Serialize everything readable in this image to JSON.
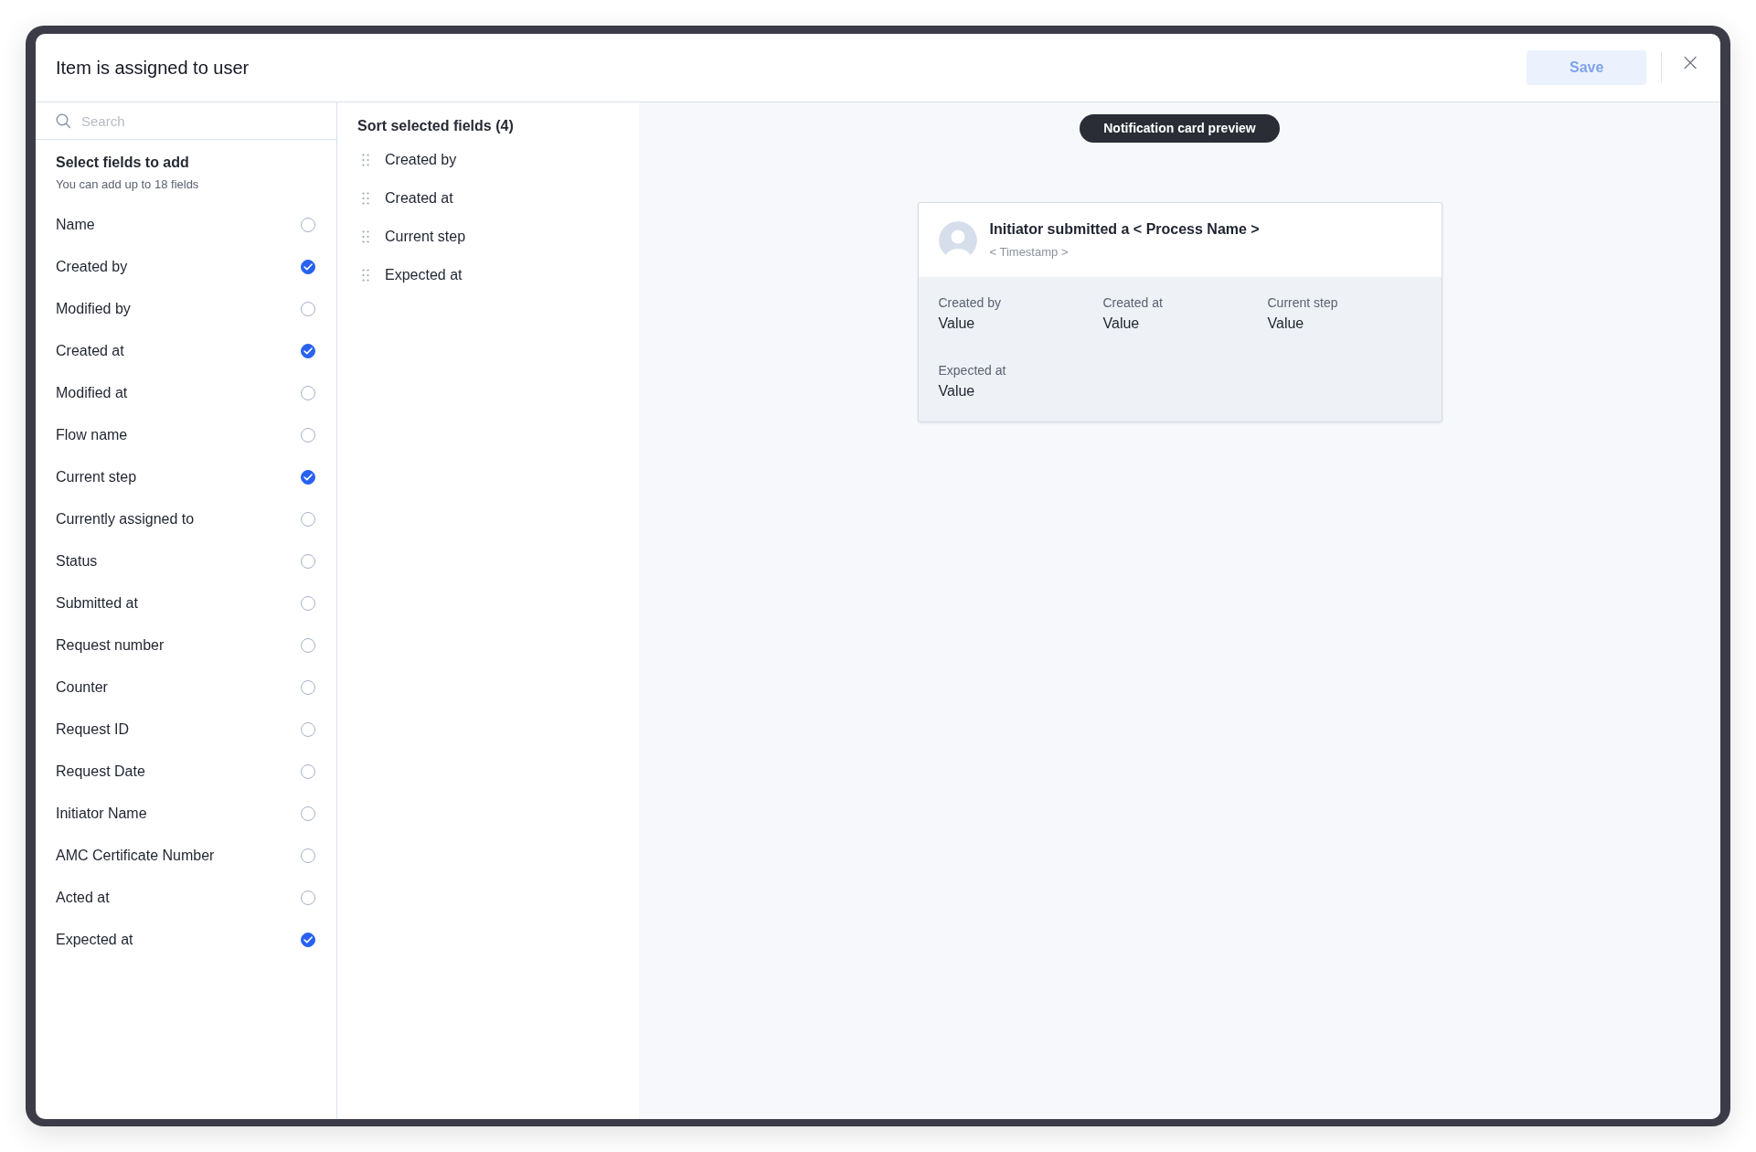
{
  "dialog": {
    "title": "Item is assigned to user",
    "save_button": {
      "label": "Save",
      "disabled": true
    },
    "close": "×"
  },
  "search": {
    "placeholder": "Search"
  },
  "field_picker": {
    "heading": "Select fields to add",
    "subtitle": "You can add up to 18 fields",
    "fields": [
      {
        "label": "Name",
        "checked": false
      },
      {
        "label": "Created by",
        "checked": true
      },
      {
        "label": "Modified by",
        "checked": false
      },
      {
        "label": "Created at",
        "checked": true
      },
      {
        "label": "Modified at",
        "checked": false
      },
      {
        "label": "Flow name",
        "checked": false
      },
      {
        "label": "Current step",
        "checked": true
      },
      {
        "label": "Currently assigned to",
        "checked": false
      },
      {
        "label": "Status",
        "checked": false
      },
      {
        "label": "Submitted at",
        "checked": false
      },
      {
        "label": "Request number",
        "checked": false
      },
      {
        "label": "Counter",
        "checked": false
      },
      {
        "label": "Request ID",
        "checked": false
      },
      {
        "label": "Request Date",
        "checked": false
      },
      {
        "label": "Initiator Name",
        "checked": false
      },
      {
        "label": "AMC Certificate Number",
        "checked": false
      },
      {
        "label": "Acted at",
        "checked": false
      },
      {
        "label": "Expected at",
        "checked": true
      }
    ]
  },
  "sort_list": {
    "heading": "Sort selected fields (4)",
    "items": [
      "Created by",
      "Created at",
      "Current step",
      "Expected at"
    ]
  },
  "preview": {
    "badge": "Notification card preview",
    "card": {
      "title": "Initiator submitted a < Process Name >",
      "timestamp": "< Timestamp >",
      "fields": [
        {
          "label": "Created by",
          "value": "Value"
        },
        {
          "label": "Created at",
          "value": "Value"
        },
        {
          "label": "Current step",
          "value": "Value"
        },
        {
          "label": "Expected at",
          "value": "Value"
        }
      ]
    }
  }
}
